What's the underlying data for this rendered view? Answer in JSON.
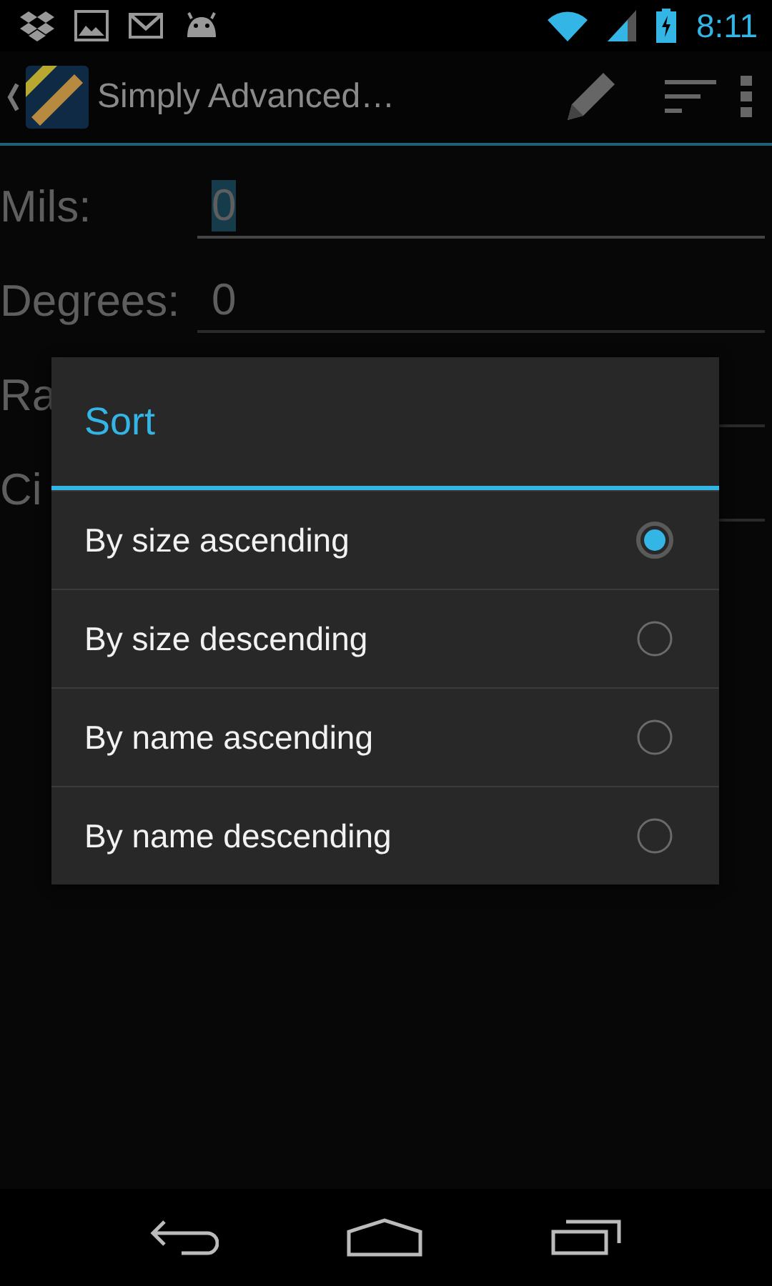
{
  "status_bar": {
    "time": "8:11"
  },
  "action_bar": {
    "title": "Simply Advanced…"
  },
  "form": {
    "rows": [
      {
        "label": "Mils:",
        "value": "0",
        "selected": true
      },
      {
        "label": "Degrees:",
        "value": "0",
        "selected": false
      },
      {
        "label": "Ra",
        "value": "",
        "selected": false
      },
      {
        "label": "Ci",
        "value": "",
        "selected": false
      }
    ]
  },
  "dialog": {
    "title": "Sort",
    "options": [
      {
        "label": "By size ascending",
        "selected": true
      },
      {
        "label": "By size descending",
        "selected": false
      },
      {
        "label": "By name ascending",
        "selected": false
      },
      {
        "label": "By name descending",
        "selected": false
      }
    ]
  }
}
